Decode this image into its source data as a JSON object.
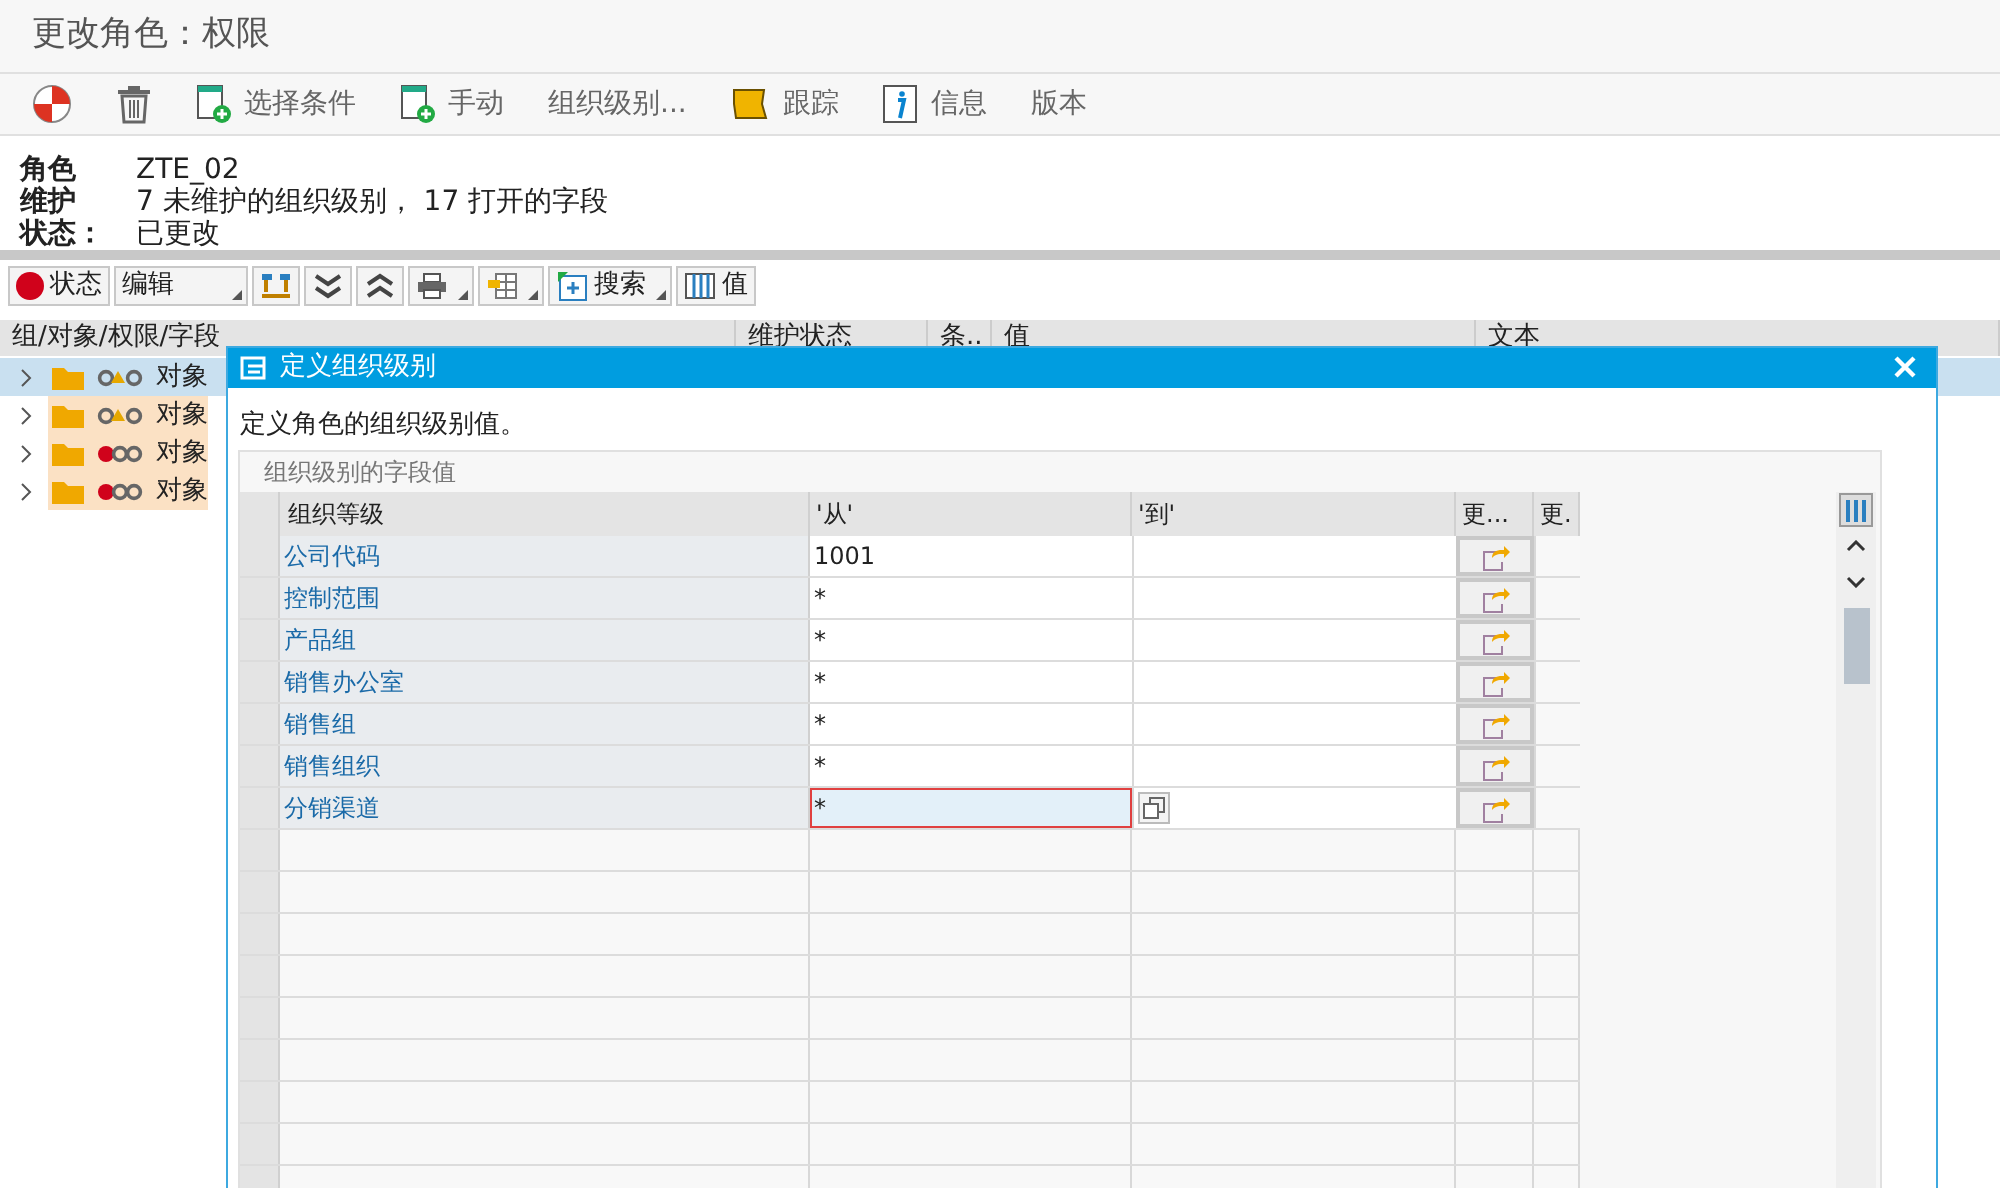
{
  "window": {
    "title": "更改角色：权限"
  },
  "toolbar": [
    {
      "kind": "status"
    },
    {
      "kind": "trash"
    },
    {
      "kind": "doc-add",
      "label": "选择条件"
    },
    {
      "kind": "doc-add",
      "label": "手动"
    },
    {
      "kind": "text",
      "label": "组织级别..."
    },
    {
      "kind": "trace",
      "label": "跟踪"
    },
    {
      "kind": "info",
      "label": "信息"
    },
    {
      "kind": "text",
      "label": "版本"
    }
  ],
  "header": [
    {
      "label": "角色",
      "value": "ZTE_02"
    },
    {
      "label": "维护",
      "value": "7 未维护的组织级别， 17 打开的字段"
    },
    {
      "label": "状态：",
      "value": "已更改"
    }
  ],
  "tree_toolbar": [
    {
      "kind": "status",
      "label": "状态",
      "dropdown": false
    },
    {
      "kind": "text",
      "label": "编辑",
      "dropdown": true
    },
    {
      "kind": "tree",
      "dropdown": false
    },
    {
      "kind": "down",
      "dropdown": false
    },
    {
      "kind": "up",
      "dropdown": false
    },
    {
      "kind": "print",
      "dropdown": true
    },
    {
      "kind": "layout",
      "dropdown": true
    },
    {
      "kind": "search",
      "label": "搜索",
      "dropdown": true
    },
    {
      "kind": "columns",
      "label": "值",
      "dropdown": false
    }
  ],
  "tree": {
    "columns": [
      "组/对象/权限/字段",
      "维护状态",
      "条..",
      "值",
      "文本"
    ],
    "rows": [
      {
        "kind": "warning",
        "text": "对象",
        "selected": true
      },
      {
        "kind": "warning",
        "text": "对象",
        "selected": false
      },
      {
        "kind": "error",
        "text": "对象",
        "selected": false
      },
      {
        "kind": "error",
        "text": "对象",
        "selected": false
      }
    ]
  },
  "dialog": {
    "title": "定义组织级别",
    "message": "定义角色的组织级别值。",
    "group_title": "组织级别的字段值",
    "columns": [
      "组织等级",
      "'从'",
      "'到'",
      "更...",
      "更."
    ],
    "rows": [
      {
        "name": "公司代码",
        "from": "1001",
        "selected": false
      },
      {
        "name": "控制范围",
        "from": "*",
        "selected": false
      },
      {
        "name": "产品组",
        "from": "*",
        "selected": false
      },
      {
        "name": "销售办公室",
        "from": "*",
        "selected": false
      },
      {
        "name": "销售组",
        "from": "*",
        "selected": false
      },
      {
        "name": "销售组织",
        "from": "*",
        "selected": false
      },
      {
        "name": "分销渠道",
        "from": "*",
        "selected": true
      }
    ]
  }
}
